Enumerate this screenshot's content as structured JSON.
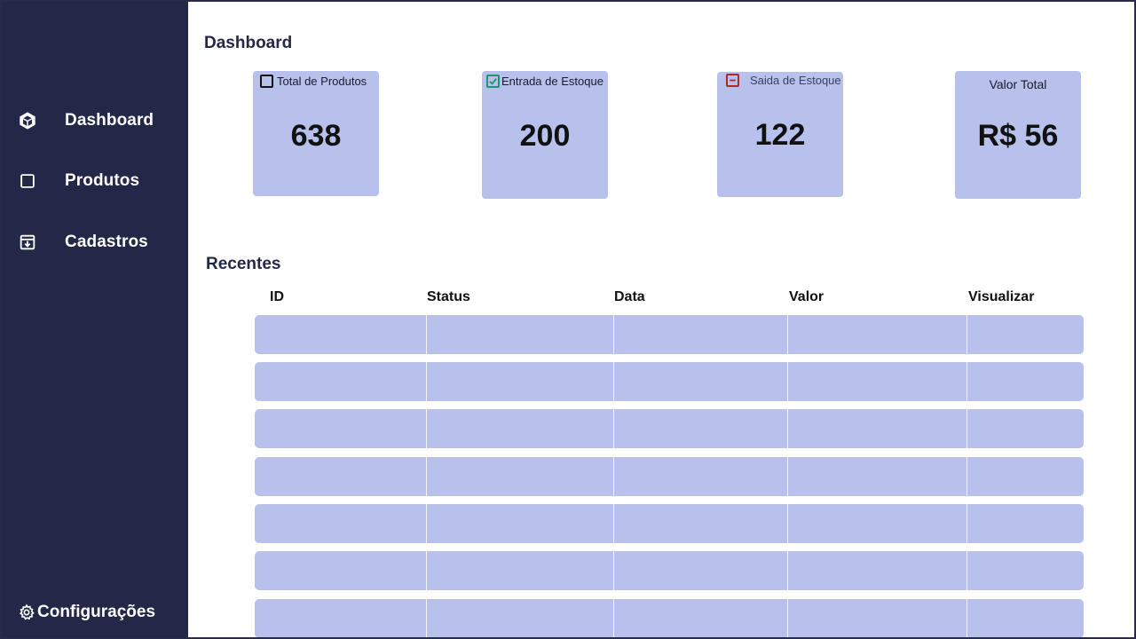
{
  "sidebar": {
    "items": [
      {
        "label": "Dashboard",
        "icon": "cube-icon"
      },
      {
        "label": "Produtos",
        "icon": "square-icon"
      },
      {
        "label": "Cadastros",
        "icon": "archive-download-icon"
      }
    ],
    "settings_label": "Configurações",
    "settings_icon": "gear-icon"
  },
  "main": {
    "title": "Dashboard",
    "cards": [
      {
        "label": "Total de Produtos",
        "value": "638",
        "icon": "empty-checkbox-icon"
      },
      {
        "label": "Entrada de Estoque",
        "value": "200",
        "icon": "checked-checkbox-icon"
      },
      {
        "label": "Saida de Estoque",
        "value": "122",
        "icon": "minus-checkbox-icon"
      },
      {
        "label": "Valor Total",
        "value": "R$ 56"
      }
    ],
    "recent": {
      "title": "Recentes",
      "columns": [
        "ID",
        "Status",
        "Data",
        "Valor",
        "Visualizar"
      ],
      "row_count": 7
    }
  },
  "colors": {
    "sidebar_bg": "#242848",
    "card_bg": "#b8c1ec",
    "check_green": "#1a9a6a",
    "minus_red": "#b02828"
  }
}
